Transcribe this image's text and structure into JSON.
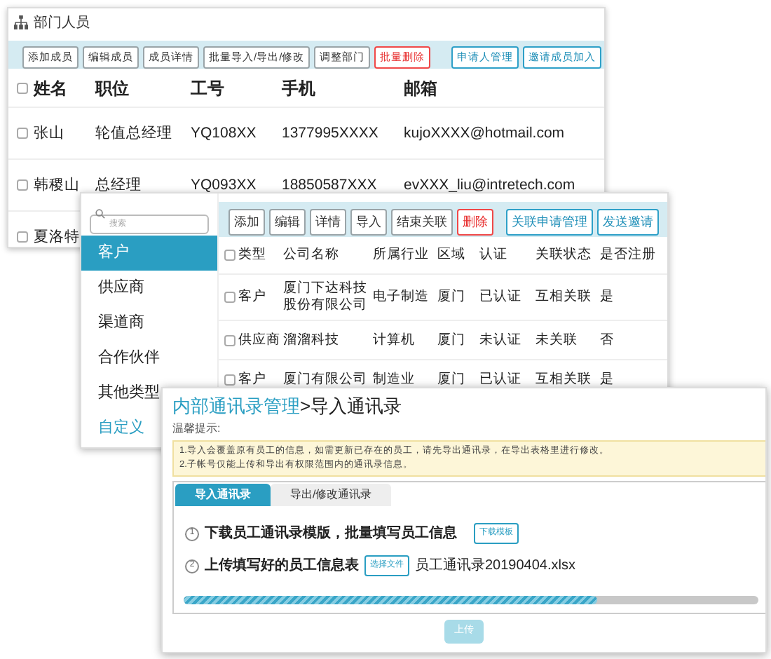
{
  "members_window": {
    "title": "部门人员",
    "toolbar": [
      {
        "label": "添加成员",
        "kind": "normal"
      },
      {
        "label": "编辑成员",
        "kind": "normal"
      },
      {
        "label": "成员详情",
        "kind": "normal"
      },
      {
        "label": "批量导入/导出/修改",
        "kind": "normal"
      },
      {
        "label": "调整部门",
        "kind": "normal"
      },
      {
        "label": "批量删除",
        "kind": "danger"
      },
      {
        "label": "申请人管理",
        "kind": "accent"
      },
      {
        "label": "邀请成员加入",
        "kind": "accent"
      }
    ],
    "header": {
      "checked": false,
      "cells": [
        "姓名",
        "职位",
        "工号",
        "手机",
        "邮箱"
      ]
    },
    "rows": [
      {
        "checked": false,
        "cells": [
          "张山",
          "轮值总经理",
          "YQ108XX",
          "1377995XXXX",
          "kujoXXXX@hotmail.com"
        ]
      },
      {
        "checked": false,
        "cells": [
          "韩稷山",
          "总经理",
          "YQ093XX",
          "18850587XXX",
          "evXXX_liu@intretech.com"
        ]
      },
      {
        "checked": false,
        "cells": [
          "夏洛特"
        ]
      }
    ]
  },
  "partners_window": {
    "search": {
      "placeholder": "搜索"
    },
    "categories": [
      {
        "label": "客户",
        "kind": "category",
        "selected": true
      },
      {
        "label": "供应商",
        "kind": "category",
        "selected": false
      },
      {
        "label": "渠道商",
        "kind": "category",
        "selected": false
      },
      {
        "label": "合作伙伴",
        "kind": "category",
        "selected": false
      },
      {
        "label": "其他类型",
        "kind": "category",
        "selected": false
      },
      {
        "label": "自定义",
        "kind": "custom",
        "selected": false
      }
    ],
    "toolbar": [
      {
        "label": "添加",
        "kind": "normal"
      },
      {
        "label": "编辑",
        "kind": "normal"
      },
      {
        "label": "详情",
        "kind": "normal"
      },
      {
        "label": "导入",
        "kind": "normal"
      },
      {
        "label": "结束关联",
        "kind": "normal"
      },
      {
        "label": "删除",
        "kind": "danger"
      },
      {
        "label": "关联申请管理",
        "kind": "accent"
      },
      {
        "label": "发送邀请",
        "kind": "accent"
      }
    ],
    "header": {
      "checked": false,
      "cells": [
        "类型",
        "公司名称",
        "所属行业",
        "区域",
        "认证",
        "关联状态",
        "是否注册"
      ]
    },
    "rows": [
      {
        "checked": false,
        "cells": [
          "客户",
          "厦门下达科技股份有限公司",
          "电子制造",
          "厦门",
          "已认证",
          "互相关联",
          "是"
        ]
      },
      {
        "checked": false,
        "cells": [
          "供应商",
          "溜溜科技",
          "计算机",
          "厦门",
          "未认证",
          "未关联",
          "否"
        ]
      },
      {
        "checked": false,
        "cells": [
          "客户",
          "厦门有限公司",
          "制造业",
          "厦门",
          "已认证",
          "互相关联",
          "是"
        ]
      }
    ]
  },
  "import_dialog": {
    "breadcrumb_parent": "内部通讯录管理",
    "breadcrumb_current": ">导入通讯录",
    "notice_title": "温馨提示:",
    "notice_lines": [
      "1.导入会覆盖原有员工的信息，如需更新已存在的员工，请先导出通讯录，在导出表格里进行修改。",
      "2.子帐号仅能上传和导出有权限范围内的通讯录信息。"
    ],
    "tabs": [
      {
        "label": "导入通讯录",
        "selected": true
      },
      {
        "label": "导出/修改通讯录",
        "selected": false
      }
    ],
    "steps": [
      {
        "number": "1",
        "text": "下载员工通讯录模版，批量填写员工信息",
        "button": "下载模板"
      },
      {
        "number": "2",
        "text": "上传填写好的员工信息表",
        "button": "选择文件",
        "file": "员工通讯录20190404.xlsx"
      }
    ],
    "progress": {
      "level": 0.72
    },
    "upload_button": {
      "label": "上传",
      "disabled": true
    }
  }
}
